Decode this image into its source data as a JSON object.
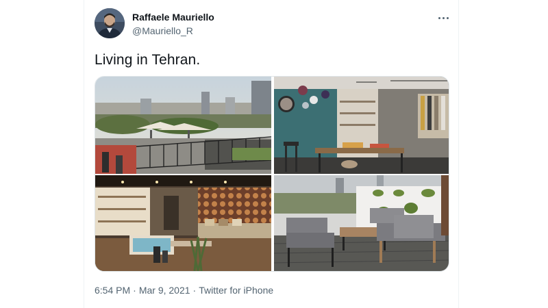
{
  "tweet": {
    "author": {
      "display_name": "Raffaele Mauriello",
      "handle": "@Mauriello_R"
    },
    "text": "Living in Tehran.",
    "media_count": 4,
    "timestamp": {
      "time": "6:54 PM",
      "separator": "·",
      "date": "Mar 9, 2021",
      "source": "Twitter for iPhone"
    }
  },
  "icons": {
    "more": "more-horizontal-icon"
  },
  "colors": {
    "text_primary": "#0f1419",
    "text_secondary": "#536471",
    "border": "#eff3f4"
  }
}
